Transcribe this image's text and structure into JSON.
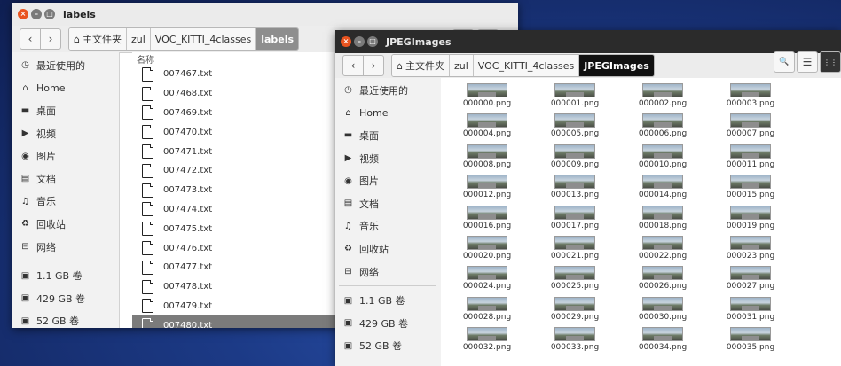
{
  "labels_window": {
    "title": "labels",
    "breadcrumbs": [
      "主文件夹",
      "zul",
      "VOC_KITTI_4classes",
      "labels"
    ],
    "sidebar": [
      {
        "label": "最近使用的",
        "icon": "clock-icon"
      },
      {
        "label": "Home",
        "icon": "home-icon"
      },
      {
        "label": "桌面",
        "icon": "desktop-folder-icon"
      },
      {
        "label": "视频",
        "icon": "video-icon"
      },
      {
        "label": "图片",
        "icon": "camera-icon"
      },
      {
        "label": "文档",
        "icon": "document-icon"
      },
      {
        "label": "音乐",
        "icon": "music-icon"
      },
      {
        "label": "回收站",
        "icon": "trash-icon"
      },
      {
        "label": "网络",
        "icon": "network-icon"
      },
      {
        "label": "1.1 GB 卷",
        "icon": "drive-icon"
      },
      {
        "label": "429 GB 卷",
        "icon": "drive-icon"
      },
      {
        "label": "52 GB 卷",
        "icon": "drive-icon"
      }
    ],
    "column_header": "名称",
    "files": [
      "007467.txt",
      "007468.txt",
      "007469.txt",
      "007470.txt",
      "007471.txt",
      "007472.txt",
      "007473.txt",
      "007474.txt",
      "007475.txt",
      "007476.txt",
      "007477.txt",
      "007478.txt",
      "007479.txt",
      "007480.txt"
    ],
    "selected_file": "007480.txt"
  },
  "jpeg_window": {
    "title": "JPEGImages",
    "breadcrumbs": [
      "主文件夹",
      "zul",
      "VOC_KITTI_4classes",
      "JPEGImages"
    ],
    "sidebar": [
      {
        "label": "最近使用的",
        "icon": "clock-icon"
      },
      {
        "label": "Home",
        "icon": "home-icon"
      },
      {
        "label": "桌面",
        "icon": "desktop-folder-icon"
      },
      {
        "label": "视频",
        "icon": "video-icon"
      },
      {
        "label": "图片",
        "icon": "camera-icon"
      },
      {
        "label": "文档",
        "icon": "document-icon"
      },
      {
        "label": "音乐",
        "icon": "music-icon"
      },
      {
        "label": "回收站",
        "icon": "trash-icon"
      },
      {
        "label": "网络",
        "icon": "network-icon"
      },
      {
        "label": "1.1 GB 卷",
        "icon": "drive-icon"
      },
      {
        "label": "429 GB 卷",
        "icon": "drive-icon"
      },
      {
        "label": "52 GB 卷",
        "icon": "drive-icon"
      }
    ],
    "images": [
      "000000.png",
      "000001.png",
      "000002.png",
      "000003.png",
      "000004.png",
      "000005.png",
      "000006.png",
      "000007.png",
      "000008.png",
      "000009.png",
      "000010.png",
      "000011.png",
      "000012.png",
      "000013.png",
      "000014.png",
      "000015.png",
      "000016.png",
      "000017.png",
      "000018.png",
      "000019.png",
      "000020.png",
      "000021.png",
      "000022.png",
      "000023.png",
      "000024.png",
      "000025.png",
      "000026.png",
      "000027.png",
      "000028.png",
      "000029.png",
      "000030.png",
      "000031.png",
      "000032.png",
      "000033.png",
      "000034.png",
      "000035.png"
    ]
  },
  "icons": {
    "back": "‹",
    "forward": "›",
    "home": "⌂",
    "search": "🔍",
    "list": "☰",
    "grid": "⋮⋮",
    "close": "×",
    "minimize": "–",
    "maximize": "□"
  },
  "colors": {
    "ubuntu_orange": "#e95420",
    "selection_grey": "#7b7b7b",
    "dark_titlebar": "#2b2b2b"
  }
}
